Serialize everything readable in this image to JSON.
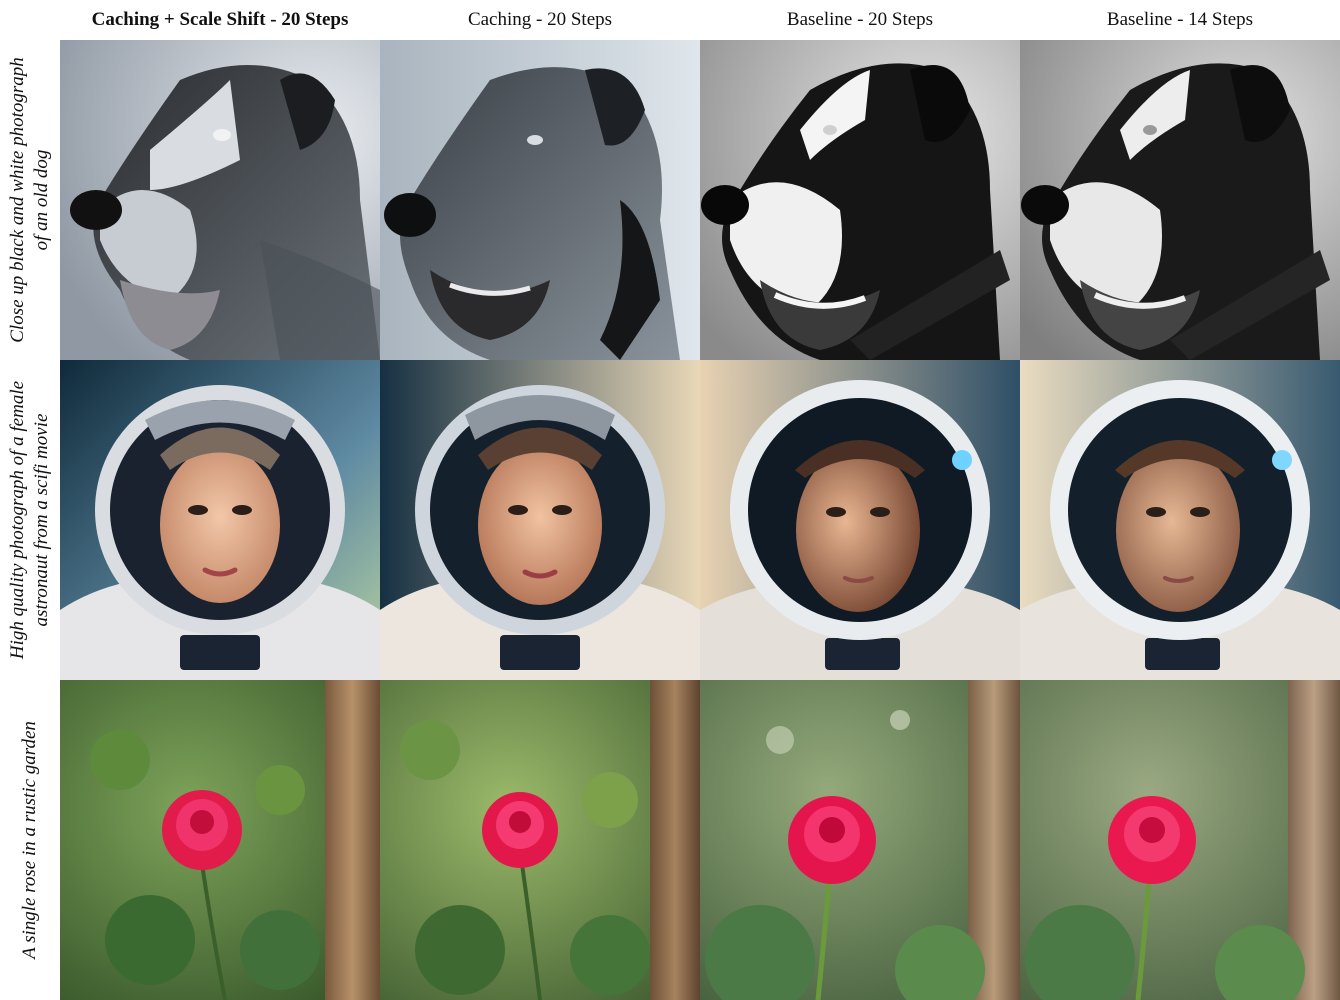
{
  "columns": [
    {
      "label": "Caching + Scale Shift - 20 Steps",
      "emphasis": "bold"
    },
    {
      "label": "Caching - 20 Steps",
      "emphasis": "normal"
    },
    {
      "label": "Baseline - 20 Steps",
      "emphasis": "normal"
    },
    {
      "label": "Baseline - 14 Steps",
      "emphasis": "normal"
    }
  ],
  "rows": [
    {
      "line1": "Close up black and white photograph",
      "line2": "of an old dog",
      "subject": "old-dog-bw"
    },
    {
      "line1": "High quality photograph of a female",
      "line2": "astronaut from a scifi movie",
      "subject": "female-astronaut"
    },
    {
      "line1": "A single rose in a rustic garden",
      "line2": "",
      "subject": "rose-garden"
    }
  ],
  "colors": {
    "dog_bg_cool": "#c9d0d8",
    "dog_bg_gray": "#b7b7b7",
    "astro_bg_teal": "#2a4a5e",
    "astro_bg_warm": "#e9d8b8",
    "rose": "#e11b4a",
    "foliage": "#3f6b2e"
  }
}
